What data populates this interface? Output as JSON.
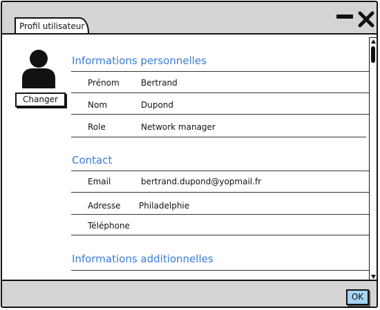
{
  "window": {
    "tab_title": "Profil utilisateur"
  },
  "profile": {
    "change_button_label": "Changer"
  },
  "sections": {
    "personal": {
      "title": "Informations personnelles",
      "fields": [
        {
          "label": "Prénom",
          "value": "Bertrand"
        },
        {
          "label": "Nom",
          "value": "Dupond"
        },
        {
          "label": "Role",
          "value": "Network manager"
        }
      ]
    },
    "contact": {
      "title": "Contact",
      "fields": [
        {
          "label": "Email",
          "value": "bertrand.dupond@yopmail.fr"
        },
        {
          "label": "Adresse",
          "value": "Philadelphie"
        },
        {
          "label": "Téléphone",
          "value": ""
        }
      ]
    },
    "additional": {
      "title": "Informations additionnelles"
    }
  },
  "footer": {
    "ok_label": "OK"
  },
  "colors": {
    "section_title": "#3a7bd5",
    "ok_button_bg": "#a6d4f2",
    "frame_bg": "#d4d4d4"
  },
  "icons": [
    "avatar-icon",
    "minimize-icon",
    "close-icon",
    "scroll-up-icon",
    "scroll-down-icon"
  ]
}
